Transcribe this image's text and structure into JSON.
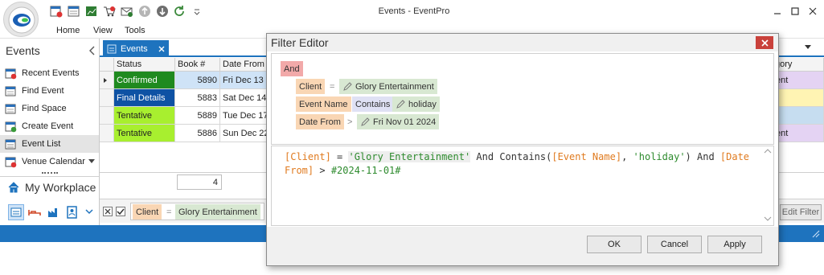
{
  "window": {
    "title": "Events - EventPro",
    "menu": [
      "Home",
      "View",
      "Tools"
    ]
  },
  "sidebar": {
    "heading": "Events",
    "items": [
      {
        "label": "Recent Events"
      },
      {
        "label": "Find Event"
      },
      {
        "label": "Find Space"
      },
      {
        "label": "Create Event"
      },
      {
        "label": "Event List"
      },
      {
        "label": "Venue Calendar"
      }
    ],
    "workplace": "My Workplace"
  },
  "tab": {
    "label": "Events"
  },
  "grid": {
    "columns": [
      "Status",
      "Book #",
      "Date From"
    ],
    "right_column": "gory",
    "rows": [
      {
        "status": "Confirmed",
        "book": "5890",
        "date": "Fri Dec 13",
        "right": "ent",
        "status_color": "#1f8a1f",
        "right_color": "#e4d3f3"
      },
      {
        "status": "Final Details",
        "book": "5883",
        "date": "Sat Dec 14",
        "right": "",
        "status_color": "#0e52a4",
        "right_color": "#fff4b3"
      },
      {
        "status": "Tentative",
        "book": "5889",
        "date": "Tue Dec 17",
        "right": "",
        "status_color": "#a8ef2f",
        "right_color": "#c6ddf0"
      },
      {
        "status": "Tentative",
        "book": "5886",
        "date": "Sun Dec 22",
        "right": "ent",
        "status_color": "#a8ef2f",
        "right_color": "#e4d3f3"
      }
    ],
    "count": "4"
  },
  "filter_bar": {
    "field": "Client",
    "op": "=",
    "value": "Glory Entertainment",
    "edit_label": "Edit Filter"
  },
  "dialog": {
    "title": "Filter Editor",
    "group": "And",
    "conditions": [
      {
        "field": "Client",
        "op": "=",
        "value": "Glory Entertainment"
      },
      {
        "field": "Event Name",
        "op": "Contains",
        "value": "holiday"
      },
      {
        "field": "Date From",
        "op": ">",
        "value": "Fri Nov 01 2024"
      }
    ],
    "expression": {
      "p1": "[Client]",
      "p2": " = ",
      "p3": "'Glory Entertainment'",
      "p4": " And Contains(",
      "p5": "[Event Name]",
      "p6": ", ",
      "p7": "'holiday'",
      "p8": ") And ",
      "p9": "[Date",
      "p10": "From]",
      "p11": " > ",
      "p12": "#2024-11-01#"
    },
    "buttons": {
      "ok": "OK",
      "cancel": "Cancel",
      "apply": "Apply"
    }
  },
  "colors": {
    "accent": "#1e73be",
    "field_token": "#f9d6b4",
    "op_token": "#dfe1f4",
    "value_token": "#d8e8d2",
    "group_token": "#f2a9a9",
    "close_red": "#c9413b"
  }
}
